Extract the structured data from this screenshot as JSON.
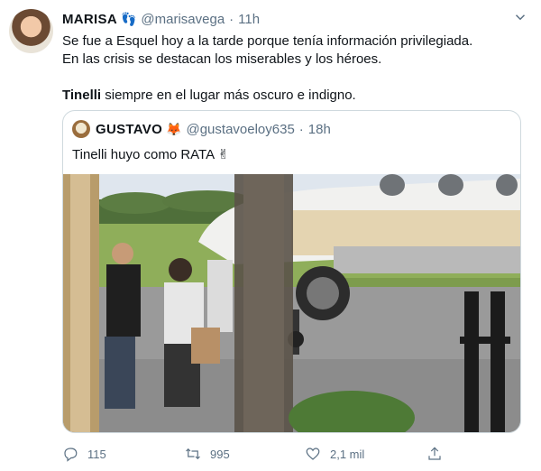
{
  "tweet": {
    "author_name": "MARISA",
    "author_emoji": "👣",
    "handle": "@marisavega",
    "separator": "·",
    "time": "11h",
    "line1": "Se fue a Esquel hoy a la tarde porque tenía información privilegiada.",
    "line2": "En las crisis se destacan los miserables y los héroes.",
    "line3_bold": "Tinelli",
    "line3_rest": " siempre en el lugar más oscuro e indigno."
  },
  "quoted": {
    "author_name": "GUSTAVO",
    "author_emoji": "🦊",
    "handle": "@gustavoeloy635",
    "separator": "·",
    "time": "18h",
    "text": "Tinelli huyo como RATA ✌"
  },
  "actions": {
    "reply_count": "115",
    "retweet_count": "995",
    "like_count": "2,1 mil"
  },
  "icons": {
    "more": "chevron-down-icon",
    "reply": "reply-icon",
    "retweet": "retweet-icon",
    "like": "heart-icon",
    "share": "share-icon"
  },
  "colors": {
    "text": "#0f1419",
    "secondary": "#5b7083",
    "border": "#cfd9de"
  }
}
